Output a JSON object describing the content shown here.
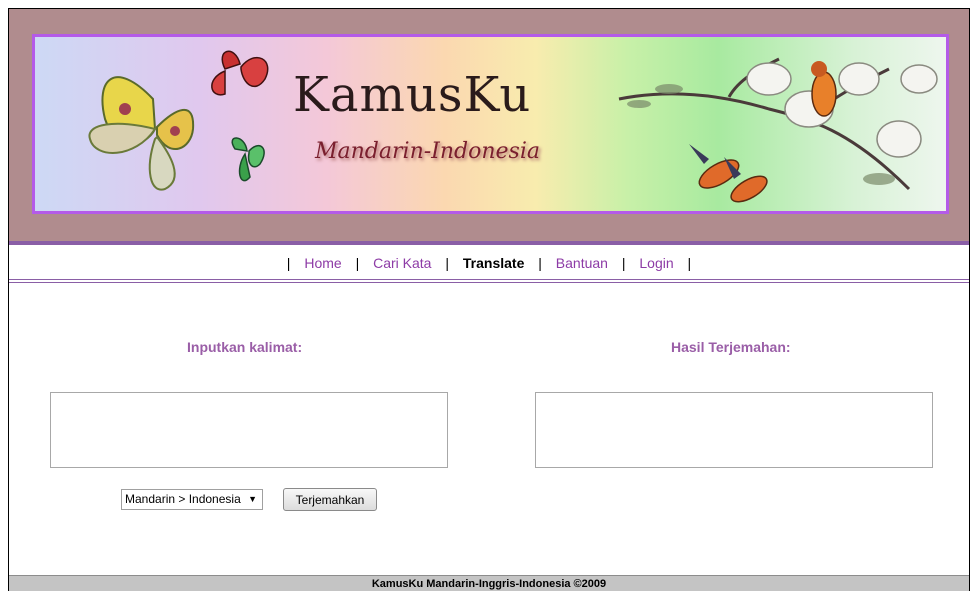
{
  "banner": {
    "title": "KamusKu",
    "subtitle": "Mandarin-Indonesia"
  },
  "nav": {
    "items": [
      {
        "label": "Home"
      },
      {
        "label": "Cari Kata"
      },
      {
        "label": "Translate",
        "active": true
      },
      {
        "label": "Bantuan"
      },
      {
        "label": "Login"
      }
    ],
    "separator": "|"
  },
  "form": {
    "input_label": "Inputkan kalimat:",
    "output_label": "Hasil Terjemahan:",
    "input_value": "",
    "output_value": "",
    "language_select": "Mandarin > Indonesia",
    "translate_button": "Terjemahkan"
  },
  "footer": {
    "text": "KamusKu Mandarin-Inggris-Indonesia ©2009"
  },
  "colors": {
    "header_band": "#b08c8e",
    "banner_border": "#b45be8",
    "accent_purple": "#8a5ea6",
    "label_purple": "#9a5ea7",
    "link_purple": "#8d3ba6",
    "footer_bg": "#c4c4c4"
  }
}
